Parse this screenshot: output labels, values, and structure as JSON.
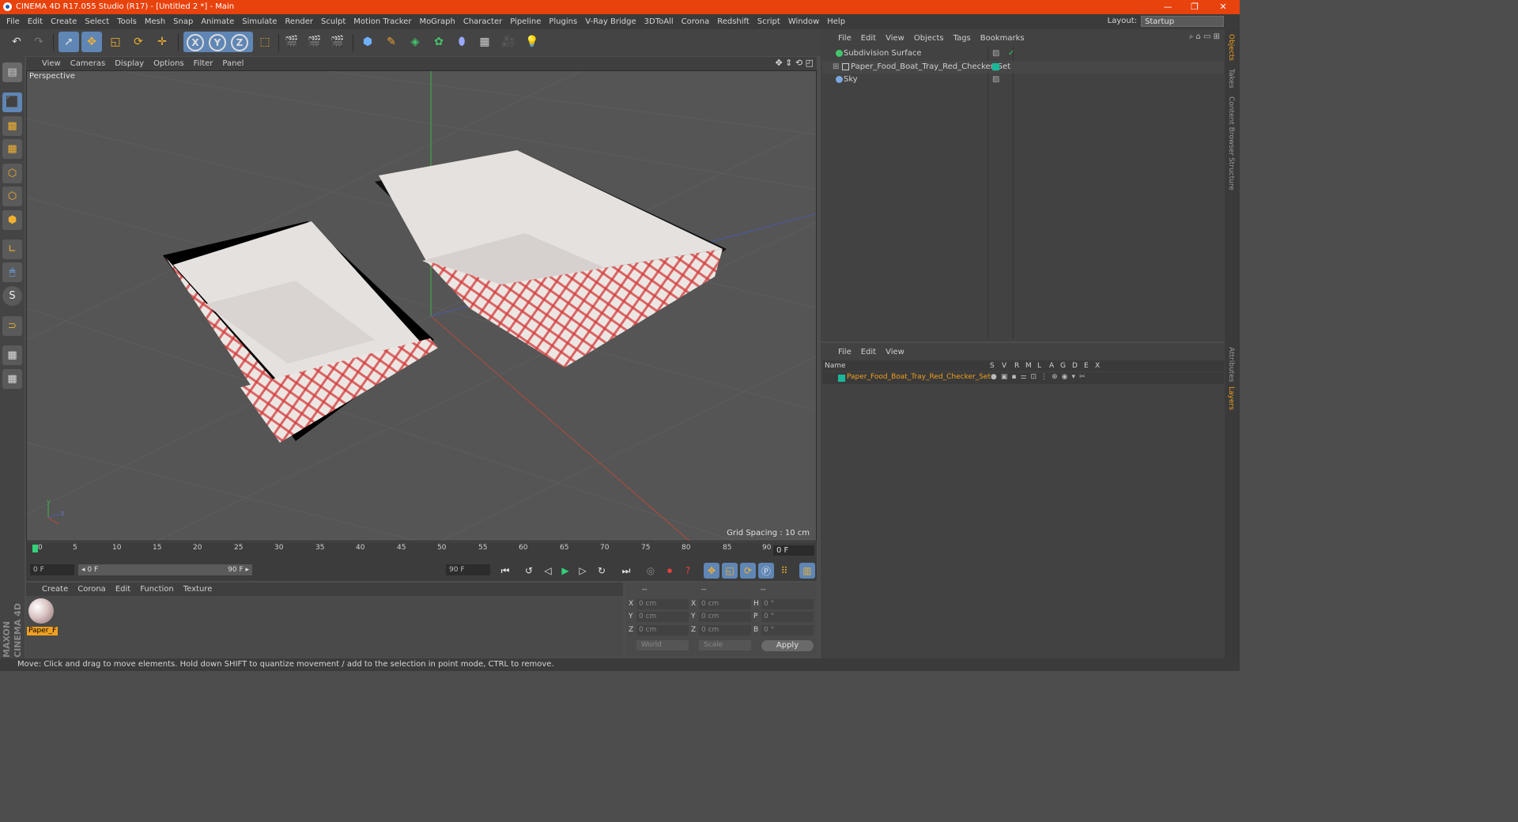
{
  "window": {
    "title": "CINEMA 4D R17.055 Studio (R17) - [Untitled 2 *] - Main",
    "min": "—",
    "restore": "❐",
    "close": "✕"
  },
  "menubar": {
    "items": [
      "File",
      "Edit",
      "Create",
      "Select",
      "Tools",
      "Mesh",
      "Snap",
      "Animate",
      "Simulate",
      "Render",
      "Sculpt",
      "Motion Tracker",
      "MoGraph",
      "Character",
      "Pipeline",
      "Plugins",
      "V-Ray Bridge",
      "3DToAll",
      "Corona",
      "Redshift",
      "Script",
      "Window",
      "Help"
    ],
    "layout_label": "Layout:",
    "layout_value": "Startup"
  },
  "viewport": {
    "menu": [
      "View",
      "Cameras",
      "Display",
      "Options",
      "Filter",
      "Panel"
    ],
    "label": "Perspective",
    "grid_spacing": "Grid Spacing : 10 cm"
  },
  "timeline": {
    "ticks": [
      "0",
      "5",
      "10",
      "15",
      "20",
      "25",
      "30",
      "35",
      "40",
      "45",
      "50",
      "55",
      "60",
      "65",
      "70",
      "75",
      "80",
      "85",
      "90"
    ],
    "current_frame": "0 F",
    "start_field": "0 F",
    "range_start": "◂ 0 F",
    "range_end": "90 F ▸",
    "end_field": "90 F"
  },
  "material_manager": {
    "menu": [
      "Create",
      "Corona",
      "Edit",
      "Function",
      "Texture"
    ],
    "material_name": "Paper_F"
  },
  "maxon_logo": "MAXON CINEMA 4D",
  "coordinates": {
    "headers": [
      "--",
      "--",
      "--"
    ],
    "rows": [
      {
        "a": "X",
        "av": "0 cm",
        "b": "X",
        "bv": "0 cm",
        "c": "H",
        "cv": "0 °"
      },
      {
        "a": "Y",
        "av": "0 cm",
        "b": "Y",
        "bv": "0 cm",
        "c": "P",
        "cv": "0 °"
      },
      {
        "a": "Z",
        "av": "0 cm",
        "b": "Z",
        "bv": "0 cm",
        "c": "B",
        "cv": "0 °"
      }
    ],
    "space": "World",
    "mode": "Scale",
    "apply": "Apply"
  },
  "object_manager": {
    "menu": [
      "File",
      "Edit",
      "View",
      "Objects",
      "Tags",
      "Bookmarks"
    ],
    "objects": [
      {
        "name": "Subdivision Surface",
        "icon_color": "#44c46a"
      },
      {
        "name": "Paper_Food_Boat_Tray_Red_Checker_Set",
        "icon_color": "#cfcfcf"
      },
      {
        "name": "Sky",
        "icon_color": "#7aa7e0"
      }
    ]
  },
  "layer_manager": {
    "menu": [
      "File",
      "Edit",
      "View"
    ],
    "columns": [
      "Name",
      "S",
      "V",
      "R",
      "M",
      "L",
      "A",
      "G",
      "D",
      "E",
      "X"
    ],
    "layer_name": "Paper_Food_Boat_Tray_Red_Checker_Set",
    "layer_color": "#19b89a"
  },
  "side_tabs": [
    "Objects",
    "Takes",
    "Content Browser",
    "Structure",
    "Attributes",
    "Layers"
  ],
  "status": "Move: Click and drag to move elements. Hold down SHIFT to quantize movement / add to the selection in point mode, CTRL to remove.",
  "colors": {
    "accent": "#e8420d",
    "selection": "#5f86b5",
    "frame_marker": "#32d07a"
  }
}
